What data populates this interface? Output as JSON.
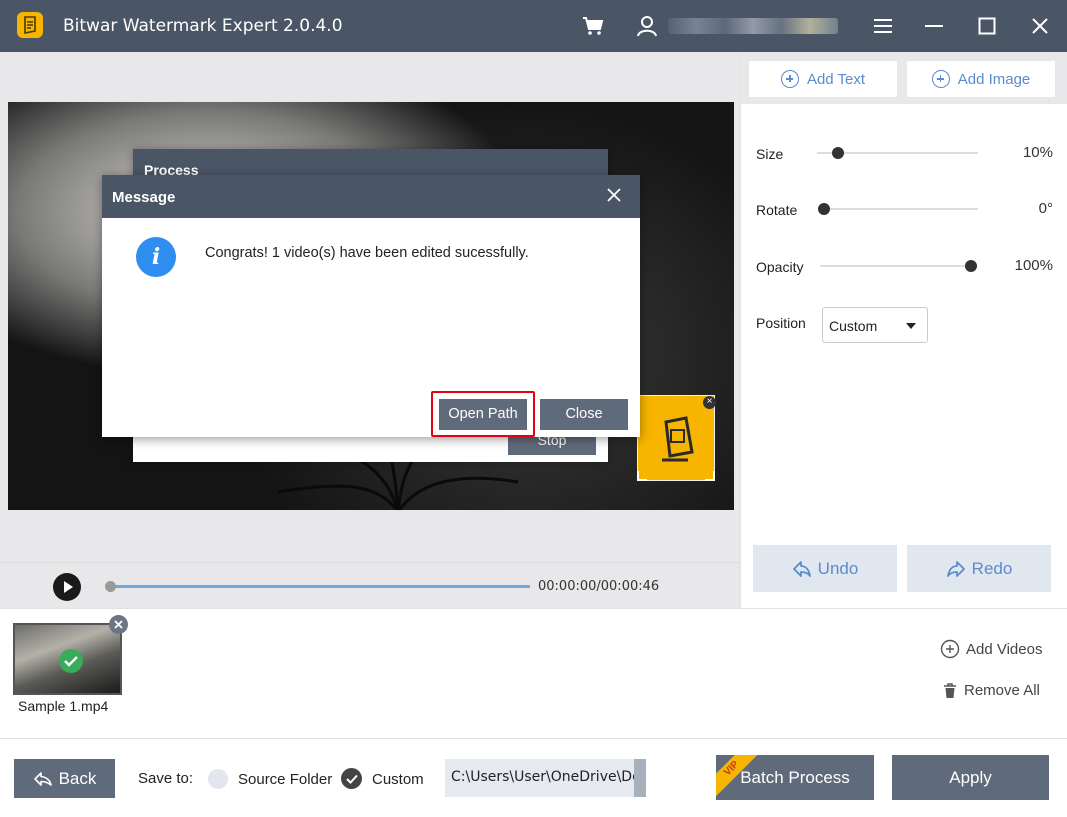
{
  "app": {
    "title": "Bitwar Watermark Expert  2.0.4.0",
    "accent_color": "#4a5566",
    "logo_color": "#f7b500"
  },
  "titlebar": {
    "icons": [
      "cart-icon",
      "user-icon",
      "menu-icon",
      "minimize-icon",
      "maximize-icon",
      "close-icon"
    ]
  },
  "toolbar": {
    "add_text": "Add Text",
    "add_image": "Add Image"
  },
  "progress_dialog": {
    "title": "Process",
    "stop_label": "Stop"
  },
  "message_dialog": {
    "title": "Message",
    "text": "Congrats! 1 video(s) have been edited sucessfully.",
    "open_path_label": "Open Path",
    "close_label": "Close",
    "highlight_color": "#e60012"
  },
  "controls": {
    "size": {
      "label": "Size",
      "value": "10%",
      "level": 0.1
    },
    "rotate": {
      "label": "Rotate",
      "value": "0°",
      "level": 0.0
    },
    "opacity": {
      "label": "Opacity",
      "value": "100%",
      "level": 1.0
    },
    "position": {
      "label": "Position",
      "value": "Custom"
    }
  },
  "history": {
    "undo": "Undo",
    "redo": "Redo"
  },
  "player": {
    "timecode": "00:00:00/00:00:46",
    "progress": 0.0
  },
  "files": {
    "items": [
      {
        "name": "Sample 1.mp4",
        "status": "done"
      }
    ],
    "add_videos": "Add Videos",
    "remove_all": "Remove All"
  },
  "bottom": {
    "back": "Back",
    "save_to": "Save to:",
    "source_folder": "Source Folder",
    "custom": "Custom",
    "selected_option": "Custom",
    "path": "C:\\Users\\User\\OneDrive\\De",
    "vip_badge": "VIP",
    "batch_process": "Batch Process",
    "apply": "Apply"
  }
}
